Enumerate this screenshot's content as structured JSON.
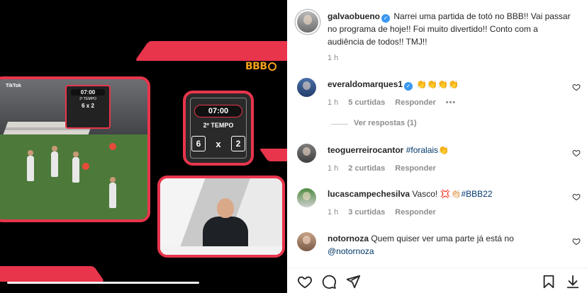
{
  "media": {
    "logo_text": "BBB",
    "tiktok_label": "TikTok",
    "scoreboard": {
      "time": "07:00",
      "period": "2º TEMPO",
      "home": "6",
      "separator": "x",
      "away": "2"
    },
    "video_progress": 0.67
  },
  "post": {
    "author": "galvaobueno",
    "caption": "Narrei uma partida de totó no BBB!! Vai passar no programa de hoje!! Foi muito divertido!! Conto com a audiência de todos!! TMJ!!",
    "time": "1 h"
  },
  "comments": [
    {
      "user": "everaldomarques1",
      "verified": true,
      "text": "👏👏👏👏",
      "time": "1 h",
      "likes": "5 curtidas",
      "reply": "Responder",
      "more": "•••",
      "view_replies": "Ver respostas (1)"
    },
    {
      "user": "teoguerreirocantor",
      "verified": false,
      "text": "#foralais",
      "emoji": "👏",
      "time": "1 h",
      "likes": "2 curtidas",
      "reply": "Responder"
    },
    {
      "user": "lucascampechesilva",
      "verified": false,
      "text": "Vasco!",
      "emoji": "💢👏🏻",
      "tag": "#BBB22",
      "time": "1 h",
      "likes": "3 curtidas",
      "reply": "Responder"
    },
    {
      "user": "notornoza",
      "verified": false,
      "text": "Quem quiser ver uma parte já está no",
      "mention": "@notornoza"
    }
  ],
  "icons": {
    "verified": "verified-badge-icon",
    "heart": "heart-icon",
    "comment": "comment-icon",
    "share": "share-icon",
    "save": "bookmark-icon",
    "download": "download-icon"
  },
  "colors": {
    "accent": "#e8354c",
    "link": "#00376b",
    "verified": "#3897f0"
  }
}
